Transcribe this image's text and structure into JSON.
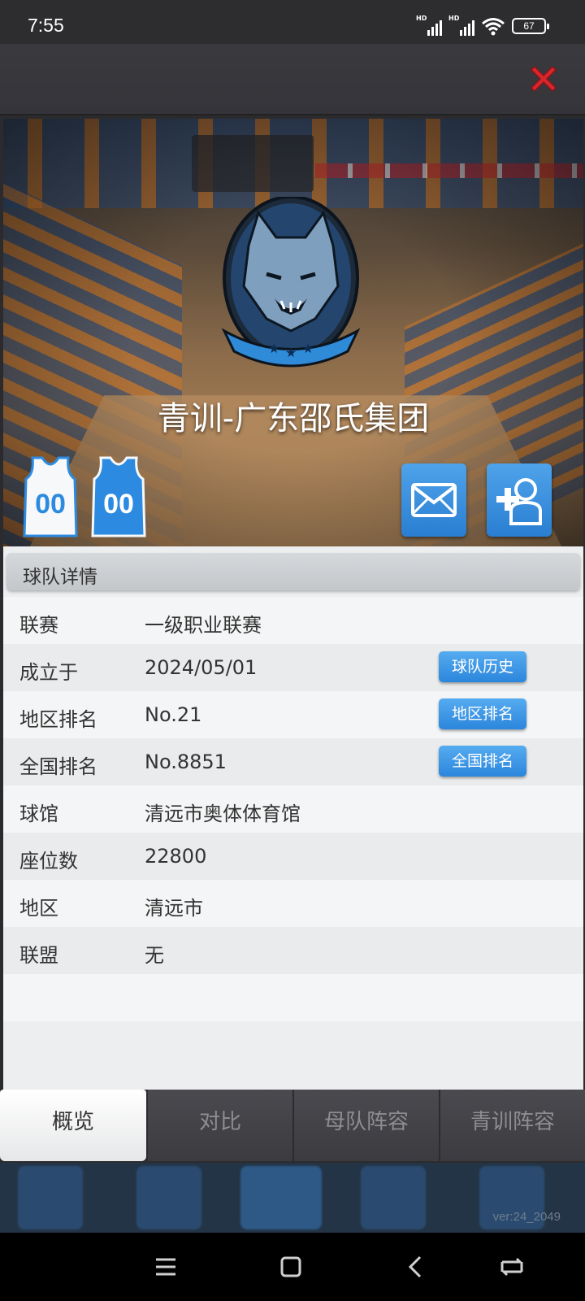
{
  "status_bar": {
    "time": "7:55",
    "battery": "67",
    "signal_label": "HD"
  },
  "team": {
    "name": "青训-广东邵氏集团",
    "jersey_home_number": "00",
    "jersey_away_number": "00"
  },
  "colors": {
    "accent": "#2b86dc",
    "close": "#d8262d",
    "panel": "#eceeef"
  },
  "icons": {
    "close": "close-icon",
    "mail": "mail-icon",
    "add_friend": "add-friend-icon",
    "logo": "wolf-logo-icon"
  },
  "details": {
    "section_title": "球队详情",
    "rows": [
      {
        "label": "联赛",
        "value": "一级职业联赛",
        "button": ""
      },
      {
        "label": "成立于",
        "value": "2024/05/01",
        "button": "球队历史"
      },
      {
        "label": "地区排名",
        "value": "No.21",
        "button": "地区排名"
      },
      {
        "label": "全国排名",
        "value": "No.8851",
        "button": "全国排名"
      },
      {
        "label": "球馆",
        "value": "清远市奥体体育馆",
        "button": ""
      },
      {
        "label": "座位数",
        "value": "22800",
        "button": ""
      },
      {
        "label": "地区",
        "value": "清远市",
        "button": ""
      },
      {
        "label": "联盟",
        "value": "无",
        "button": ""
      }
    ]
  },
  "tabs": [
    {
      "label": "概览",
      "active": true
    },
    {
      "label": "对比",
      "active": false
    },
    {
      "label": "母队阵容",
      "active": false
    },
    {
      "label": "青训阵容",
      "active": false
    }
  ],
  "version": "ver:24_2049"
}
